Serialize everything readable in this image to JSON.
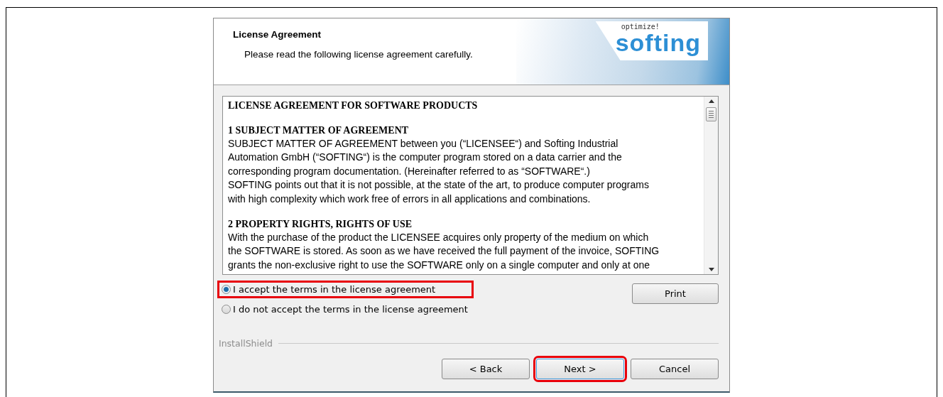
{
  "header": {
    "title": "License Agreement",
    "subtitle": "Please read the following license agreement carefully.",
    "logo": {
      "tagline": "optimize!",
      "name": "softing"
    }
  },
  "license": [
    {
      "kind": "title",
      "text": "LICENSE AGREEMENT FOR SOFTWARE PRODUCTS"
    },
    {
      "kind": "heading",
      "text": "1 SUBJECT MATTER OF AGREEMENT"
    },
    {
      "kind": "line",
      "text": "SUBJECT MATTER OF AGREEMENT between you (“LICENSEE“) and Softing Industrial"
    },
    {
      "kind": "line",
      "text": "Automation GmbH (“SOFTING“) is the computer program stored on a data carrier and the"
    },
    {
      "kind": "line",
      "text": "corresponding program documentation. (Hereinafter referred to as “SOFTWARE“.)"
    },
    {
      "kind": "line",
      "text": "SOFTING points out that it is not possible, at the state of the art, to produce computer programs"
    },
    {
      "kind": "line",
      "text": "with high complexity which work free of errors in all applications and combinations."
    },
    {
      "kind": "heading",
      "text": "2 PROPERTY RIGHTS, RIGHTS OF USE"
    },
    {
      "kind": "line",
      "text": "With the purchase of the product the LICENSEE acquires only property of the medium on which"
    },
    {
      "kind": "line",
      "text": "the SOFTWARE is stored. As soon as we have received the full payment of the invoice, SOFTING"
    },
    {
      "kind": "line",
      "text": "grants the non-exclusive right to use the SOFTWARE only on a single computer and only at one"
    }
  ],
  "options": [
    {
      "label": "I accept the terms in the license agreement",
      "selected": true,
      "highlighted": true
    },
    {
      "label": "I do not accept the terms in the license agreement",
      "selected": false,
      "highlighted": false
    }
  ],
  "print_button": {
    "label": "Print"
  },
  "brand": "InstallShield",
  "buttons": [
    {
      "label": "< Back",
      "highlighted": false,
      "default": false
    },
    {
      "label": "Next >",
      "highlighted": true,
      "default": true
    },
    {
      "label": "Cancel",
      "highlighted": false,
      "default": false
    }
  ]
}
